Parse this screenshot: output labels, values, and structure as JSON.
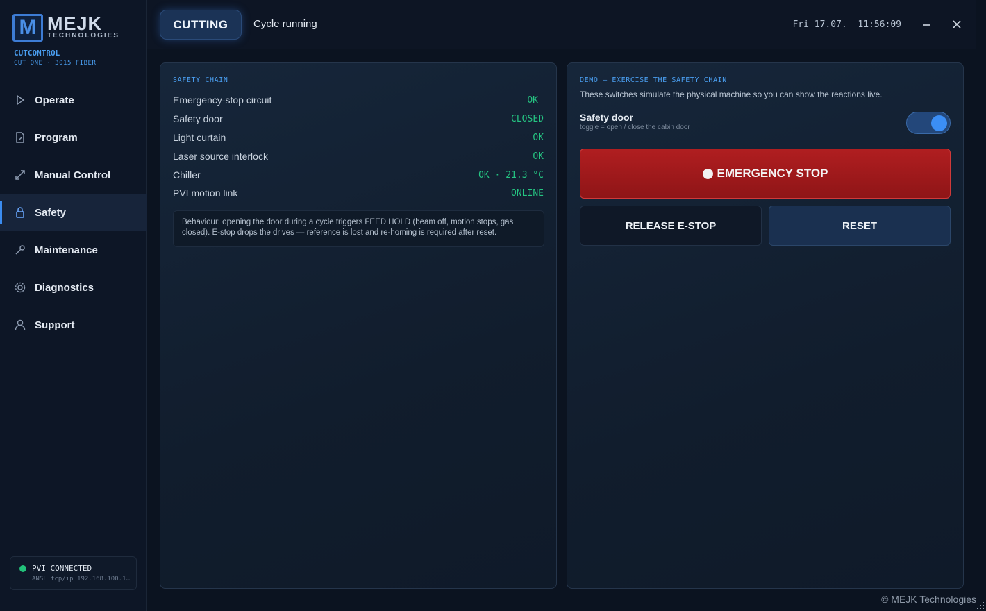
{
  "brand": {
    "logo_mark": "M",
    "name": "MEJK",
    "sub": "TECHNOLOGIES",
    "app_title": "CUTCONTROL",
    "app_sub": "CUT ONE · 3015 FIBER"
  },
  "nav": {
    "items": [
      {
        "label": "Operate",
        "icon": "play-icon"
      },
      {
        "label": "Program",
        "icon": "file-edit-icon"
      },
      {
        "label": "Manual Control",
        "icon": "diagonal-arrows-icon"
      },
      {
        "label": "Safety",
        "icon": "lock-icon",
        "active": true
      },
      {
        "label": "Maintenance",
        "icon": "wrench-icon"
      },
      {
        "label": "Diagnostics",
        "icon": "gear-icon"
      },
      {
        "label": "Support",
        "icon": "user-icon"
      }
    ]
  },
  "connection": {
    "title": "PVI CONNECTED",
    "detail": "ANSL tcp/ip 192.168.100.1…",
    "status_color": "#22c27a"
  },
  "topbar": {
    "mode": "CUTTING",
    "cycle_status": "Cycle running",
    "datetime": "Fri 17.07.  11:56:09"
  },
  "safety_chain": {
    "title": "SAFETY CHAIN",
    "rows": [
      {
        "label": "Emergency-stop circuit",
        "value": "OK"
      },
      {
        "label": "Safety door",
        "value": "CLOSED"
      },
      {
        "label": "Light curtain",
        "value": "OK"
      },
      {
        "label": "Laser source interlock",
        "value": "OK"
      },
      {
        "label": "Chiller",
        "value": "OK · 21.3 °C"
      },
      {
        "label": "PVI motion link",
        "value": "ONLINE"
      }
    ],
    "note": "Behaviour: opening the door during a cycle triggers FEED HOLD (beam off, motion stops, gas closed). E-stop drops the drives — reference is lost and re-homing is required after reset."
  },
  "demo": {
    "title": "DEMO — EXERCISE THE SAFETY CHAIN",
    "description": "These switches simulate the physical machine so you can show the reactions live.",
    "door_label": "Safety door",
    "door_hint": "toggle = open / close the cabin door",
    "door_toggle_on": true,
    "estop_label": "EMERGENCY STOP",
    "release_label": "RELEASE E-STOP",
    "reset_label": "RESET"
  },
  "footer": {
    "copyright": "© MEJK Technologies"
  },
  "colors": {
    "accent": "#3b8cf0",
    "ok_green": "#25c482",
    "estop_red": "#b01e20"
  }
}
